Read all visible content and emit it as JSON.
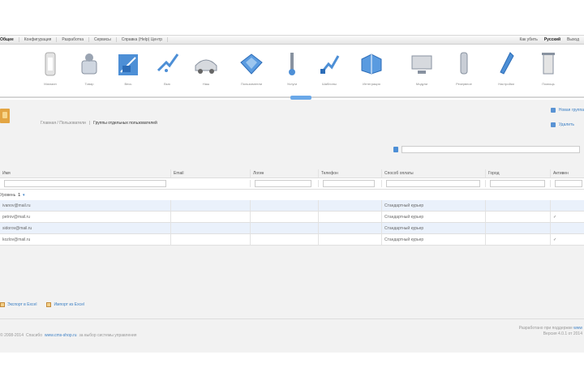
{
  "topmenu": {
    "items": [
      "Общее",
      "Конфигурация",
      "Разработка",
      "Сервисы",
      "Справка (Help) Центр"
    ],
    "right": [
      "Как убить",
      "Русский",
      "Выход"
    ]
  },
  "toolbar": {
    "tools": [
      {
        "label": "Магазин",
        "icon": "document-icon"
      },
      {
        "label": "Товар",
        "icon": "bottle-icon"
      },
      {
        "label": "Весь",
        "icon": "box-icon"
      },
      {
        "label": "Вью",
        "icon": "arrow-icon"
      },
      {
        "label": "Наш",
        "icon": "car-icon"
      },
      {
        "label": "Пользователи",
        "icon": "users-icon"
      },
      {
        "label": "Услуги",
        "icon": "tool-icon"
      },
      {
        "label": "Шаблоны",
        "icon": "chart-icon"
      },
      {
        "label": "Интеграция",
        "icon": "puzzle-icon"
      },
      {
        "label": "Модули",
        "icon": "monitor-icon"
      },
      {
        "label": "Резервное",
        "icon": "bottle-icon"
      },
      {
        "label": "Настройки",
        "icon": "pen-icon"
      },
      {
        "label": "Помощь",
        "icon": "trash-icon"
      }
    ]
  },
  "breadcrumb": {
    "parent": "Главная / Пользователи",
    "current": "Группы отдельных пользователей"
  },
  "actions": [
    "Новая группа",
    "Удалить"
  ],
  "search": {
    "placeholder": ""
  },
  "grid": {
    "columns": [
      "Имя",
      "Email",
      "Логин",
      "Телефон",
      "Способ оплаты",
      "Город",
      "Активен"
    ],
    "group_label": "Уровень",
    "group_value": "1",
    "rows": [
      [
        "ivanov@mail.ru",
        "",
        "",
        "",
        "Стандартный курьер",
        "",
        ""
      ],
      [
        "petrov@mail.ru",
        "",
        "",
        "",
        "Стандартный курьер",
        "",
        "✓"
      ],
      [
        "sidorov@mail.ru",
        "",
        "",
        "",
        "Стандартный курьер",
        "",
        ""
      ],
      [
        "kozlov@mail.ru",
        "",
        "",
        "",
        "Стандартный курьер",
        "",
        "✓"
      ]
    ]
  },
  "bottom_links": [
    "Экспорт в Excel",
    "Импорт из Excel"
  ],
  "footer": {
    "copyright": "© 2008-2014",
    "text1": "Спасибо",
    "link": "www.cms-shop.ru",
    "text2": "за выбор системы управления",
    "right_line1": "Разработано при поддержке",
    "right_link": "www",
    "right_line2": "Версия 4.0.1 от 2014"
  },
  "colors": {
    "accent": "#3b7fc4",
    "active": "#6aa8e8",
    "row_alt": "#eaf1fb",
    "background": "#f2f2f2"
  }
}
